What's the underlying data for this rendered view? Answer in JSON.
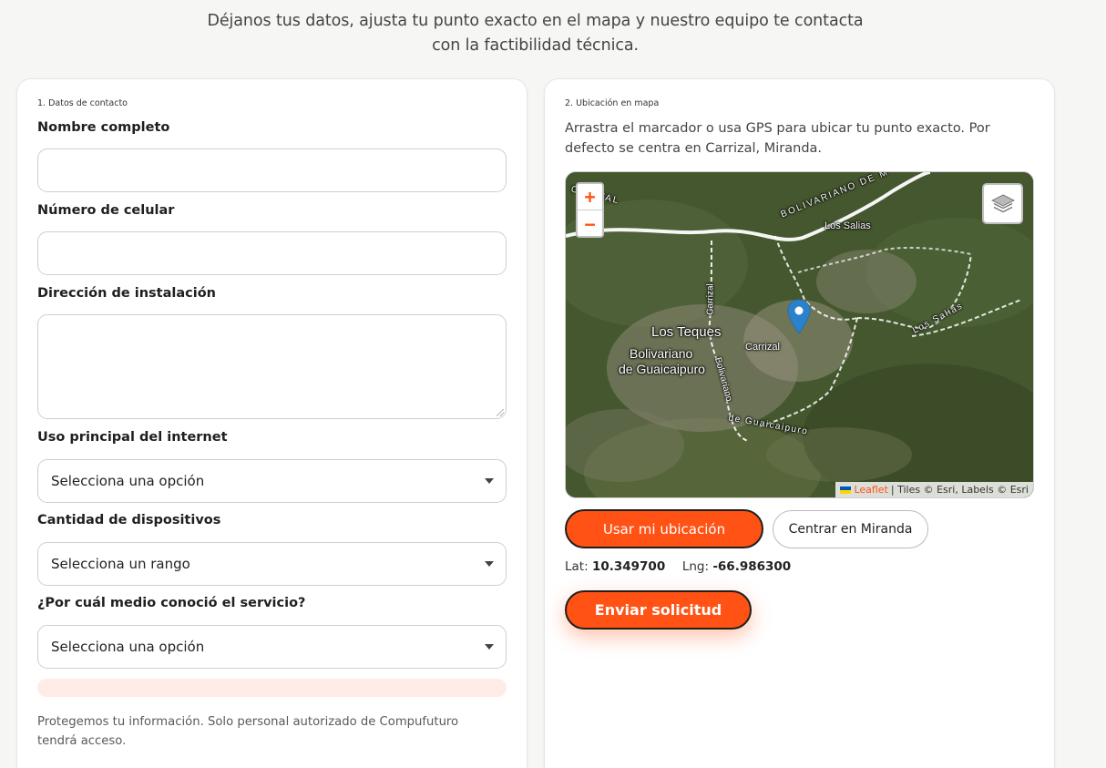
{
  "intro": {
    "line1": "Déjanos tus datos, ajusta tu punto exacto en el mapa y nuestro equipo te contacta",
    "line2": "con la factibilidad técnica."
  },
  "contact": {
    "step": "1. Datos de contacto",
    "name_label": "Nombre completo",
    "name_value": "",
    "phone_label": "Número de celular",
    "phone_value": "",
    "address_label": "Dirección de instalación",
    "address_value": "",
    "usage_label": "Uso principal del internet",
    "usage_selected": "Selecciona una opción",
    "devices_label": "Cantidad de dispositivos",
    "devices_selected": "Selecciona un rango",
    "source_label": "¿Por cuál medio conoció el servicio?",
    "source_selected": "Selecciona una opción",
    "privacy_line1": "Protegemos tu información. Solo personal autorizado de Compufuturo",
    "privacy_line2": "tendrá acceso."
  },
  "location": {
    "step": "2. Ubicación en mapa",
    "desc_line1": "Arrastra el marcador o usa GPS para ubicar tu punto exacto. Por",
    "desc_line2": "defecto se centra en Carrizal, Miranda.",
    "gps_button": "Usar mi ubicación",
    "center_button": "Centrar en Miranda",
    "lat_label": "Lat:",
    "lat_value": "10.349700",
    "lng_label": "Lng:",
    "lng_value": "-66.986300",
    "submit_button": "Enviar solicitud"
  },
  "map": {
    "zoom_in": "+",
    "zoom_out": "−",
    "layers_icon": "layers-icon",
    "marker_icon": "map-marker-icon",
    "attribution_link": "Leaflet",
    "attribution_text": "| Tiles © Esri, Labels © Esri",
    "labels": {
      "capital": "CAPITAL",
      "bolivariano_road": "BOLIVARIANO DE M",
      "los_salias": "Los Salias",
      "carrizal_road": "Carrizal",
      "los_teques": "Los Teques",
      "bolivariano": "Bolivariano",
      "de_guaicaipuro": "de Guaicaipuro",
      "carrizal": "Carrizal",
      "bolivariano_vertical": "Bolivariano",
      "de_guaicaipuro_road": "de Guaicaipuro",
      "los_salias_road": "Los Salias"
    }
  },
  "colors": {
    "accent": "#ff5214",
    "page_bg": "#f6f6f5",
    "marker": "#2b82cb"
  }
}
